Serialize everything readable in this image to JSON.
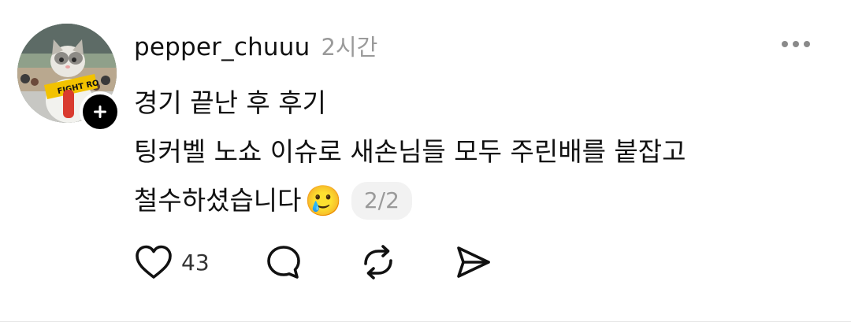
{
  "post": {
    "author": {
      "username": "pepper_chuuu",
      "time": "2시간",
      "avatar_icon": "cat-avatar"
    },
    "follow_icon": "plus-icon",
    "more_icon": "more-dots-icon",
    "text_lines": [
      "경기 끝난 후 후기",
      "팅커벨 노쇼 이슈로 새손님들 모두 주린배를 붙잡고",
      "철수하셨습니다"
    ],
    "emoji": "🥲",
    "pager": "2/2",
    "actions": {
      "like": {
        "icon": "heart-icon",
        "count": "43"
      },
      "comment": {
        "icon": "comment-icon"
      },
      "repost": {
        "icon": "repost-icon"
      },
      "share": {
        "icon": "send-icon"
      }
    }
  },
  "colors": {
    "text": "#111111",
    "muted": "#9a9a9a",
    "badge_bg": "#000000",
    "pill_bg": "#f2f2f2"
  }
}
